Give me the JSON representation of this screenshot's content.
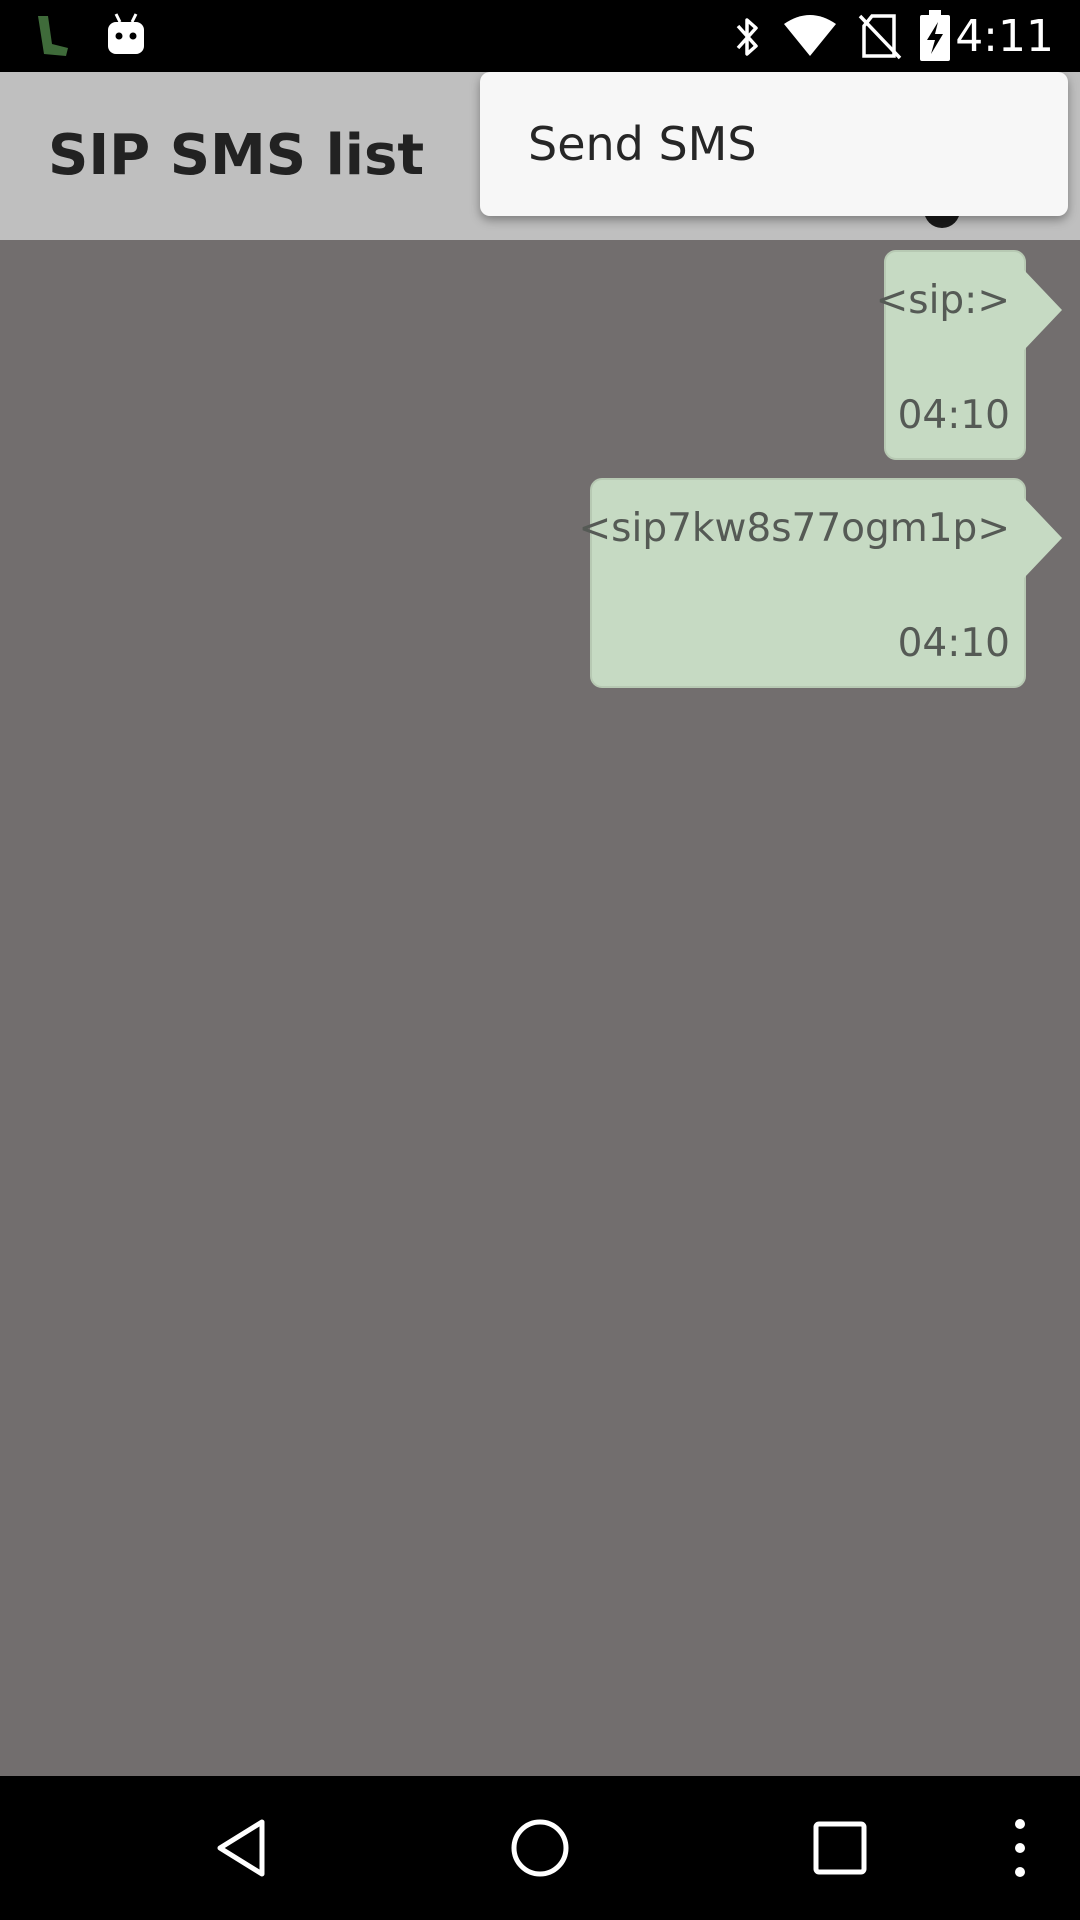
{
  "status_bar": {
    "time": "4:11",
    "left_icons": [
      "phone-app-icon",
      "android-debug-icon"
    ],
    "right_icons": [
      "bluetooth-icon",
      "wifi-icon",
      "no-sim-icon",
      "battery-charging-icon"
    ]
  },
  "app_bar": {
    "title": "SIP SMS list",
    "overflow_icon": "overflow-menu-icon"
  },
  "popup_menu": {
    "items": [
      {
        "label": "Send SMS"
      }
    ]
  },
  "messages": [
    {
      "from": "<sip:>",
      "time": "04:10"
    },
    {
      "from": "<sip7kw8s77ogm1p>",
      "time": "04:10"
    }
  ],
  "colors": {
    "background": "#726e6e",
    "app_bar": "#bfbfbf",
    "bubble": "#c6dac3",
    "popup": "#f7f7f7"
  },
  "nav_bar": {
    "icons": [
      "back-icon",
      "home-icon",
      "recents-icon",
      "more-icon"
    ]
  }
}
